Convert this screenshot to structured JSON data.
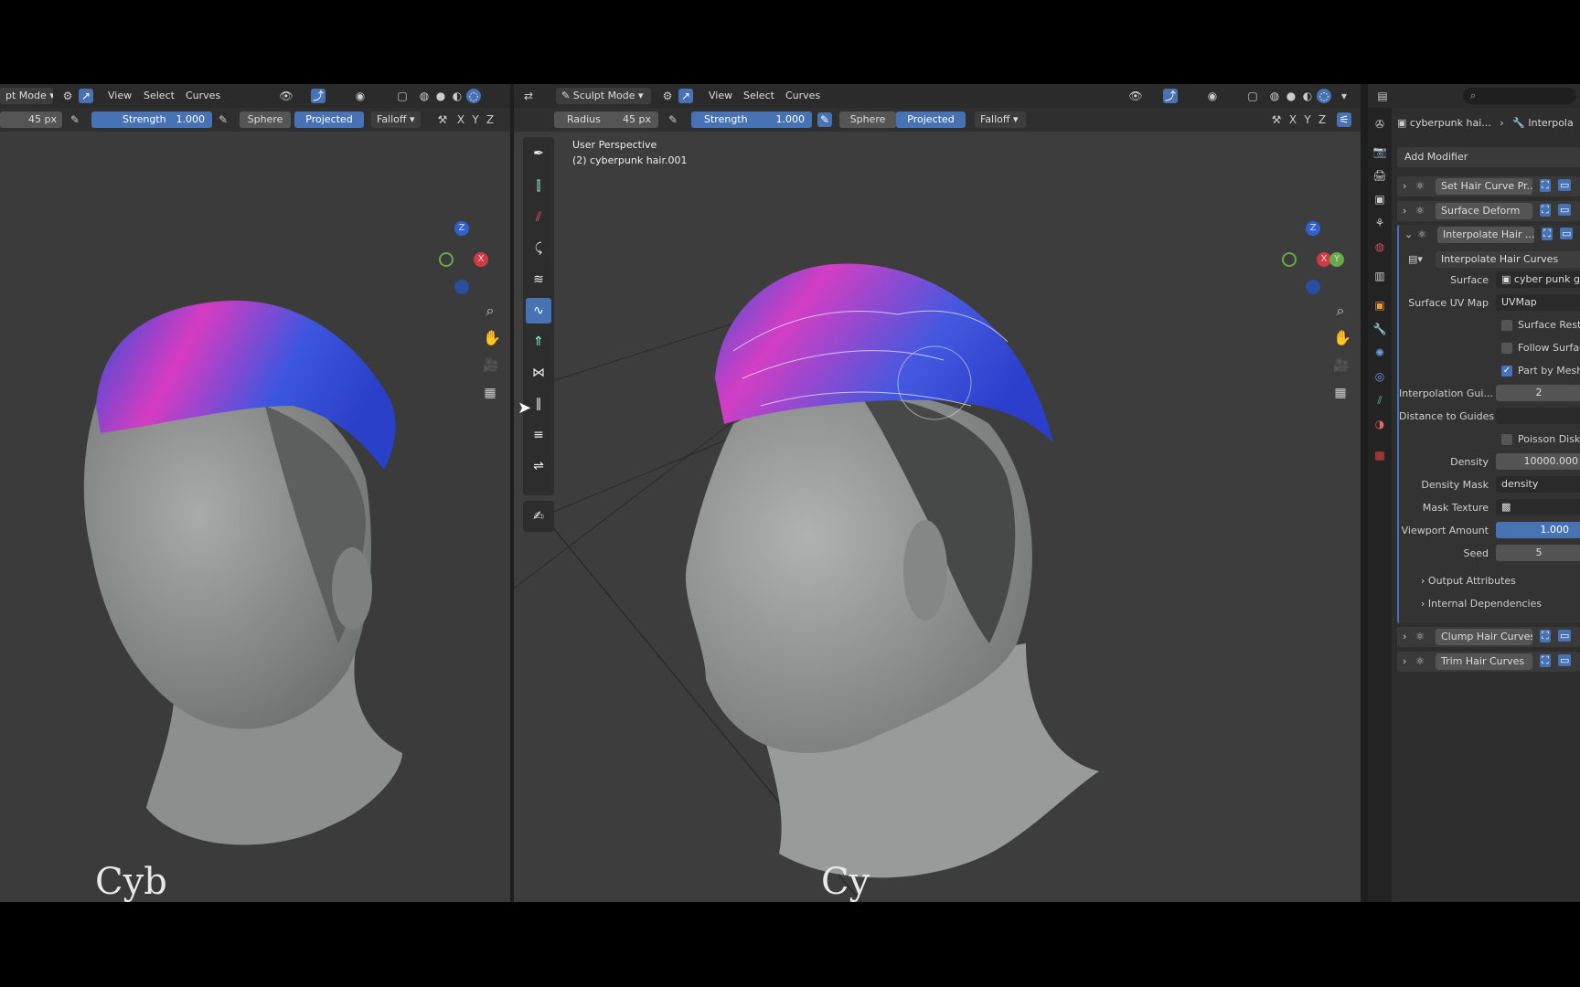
{
  "left_view": {
    "mode_label": "pt Mode",
    "menu": [
      "View",
      "Select",
      "Curves"
    ],
    "radius_value": "45 px",
    "strength_label": "Strength",
    "strength_value": "1.000",
    "sphere_label": "Sphere",
    "projected_label": "Projected",
    "falloff_label": "Falloff",
    "axes": [
      "X",
      "Y",
      "Z"
    ],
    "watermark": "Cyb"
  },
  "main_view": {
    "mode_label": "Sculpt Mode",
    "menu": [
      "View",
      "Select",
      "Curves"
    ],
    "radius_label": "Radius",
    "radius_value": "45 px",
    "strength_label": "Strength",
    "strength_value": "1.000",
    "sphere_label": "Sphere",
    "projected_label": "Projected",
    "falloff_label": "Falloff",
    "axes": [
      "X",
      "Y",
      "Z"
    ],
    "overlay_line1": "User Perspective",
    "overlay_line2": "(2) cyberpunk hair.001",
    "watermark": "Cy",
    "gizmo": {
      "z": "Z",
      "x": "X",
      "y": "Y"
    }
  },
  "left_gizmo": {
    "z": "Z",
    "x": "X"
  },
  "properties": {
    "breadcrumb_obj": "cyberpunk hai...",
    "breadcrumb_sep": "›",
    "breadcrumb_mod": "Interpola",
    "add_modifier": "Add Modifier",
    "modifiers": [
      {
        "name": "Set Hair Curve Pr..."
      },
      {
        "name": "Surface Deform"
      },
      {
        "name": "Interpolate Hair ..."
      }
    ],
    "node_group": "Interpolate Hair Curves",
    "surface_label": "Surface",
    "surface_value": "cyber punk g",
    "uvmap_label": "Surface UV Map",
    "uvmap_value": "UVMap",
    "surface_rest": "Surface Rest P",
    "follow_surface": "Follow Surface",
    "part_by_mesh": "Part by Mesh I",
    "interp_guides_label": "Interpolation Gui...",
    "interp_guides_value": "2",
    "distance_label": "Distance to Guides",
    "poisson_label": "Poisson Disk D",
    "density_label": "Density",
    "density_value": "10000.000",
    "density_mask_label": "Density Mask",
    "density_mask_value": "density",
    "mask_texture_label": "Mask Texture",
    "viewport_amount_label": "Viewport Amount",
    "viewport_amount_value": "1.000",
    "seed_label": "Seed",
    "seed_value": "5",
    "output_attributes": "Output Attributes",
    "internal_dependencies": "Internal Dependencies",
    "modifiers_after": [
      {
        "name": "Clump Hair Curves"
      },
      {
        "name": "Trim Hair Curves"
      }
    ]
  },
  "colors": {
    "accent": "#4772b3",
    "hair_pink": "#d63cc2",
    "hair_blue": "#2f4fd8",
    "viewport_bg": "#3b3b3b",
    "skin": "#9a9c9b"
  }
}
